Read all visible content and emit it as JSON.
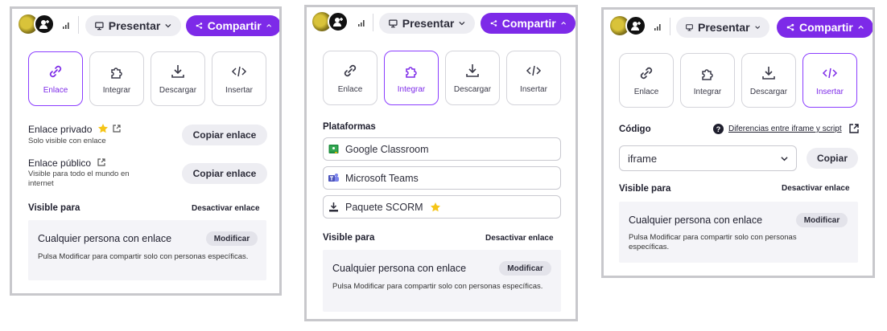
{
  "topbar": {
    "present_label": "Presentar",
    "share_label": "Compartir"
  },
  "tabs": {
    "link": "Enlace",
    "embed": "Integrar",
    "download": "Descargar",
    "insert": "Insertar"
  },
  "panel_link": {
    "private_title": "Enlace privado",
    "private_desc": "Solo visible con enlace",
    "public_title": "Enlace público",
    "public_desc": "Visible para todo el mundo en internet",
    "copy_label": "Copiar enlace"
  },
  "panel_embed": {
    "platforms_title": "Plataformas",
    "platforms": [
      "Google Classroom",
      "Microsoft Teams",
      "Paquete SCORM"
    ]
  },
  "panel_insert": {
    "code_label": "Código",
    "diff_link": "Diferencias entre iframe y script",
    "code_value": "iframe",
    "copy_label": "Copiar"
  },
  "visibility": {
    "title": "Visible para",
    "disable_link": "Desactivar enlace",
    "audience": "Cualquier persona con enlace",
    "modify": "Modificar",
    "hint": "Pulsa Modificar para compartir solo con personas específicas."
  },
  "colors": {
    "accent": "#7d2ae8",
    "pill_bg": "#ededf2",
    "star": "#f5c518"
  }
}
